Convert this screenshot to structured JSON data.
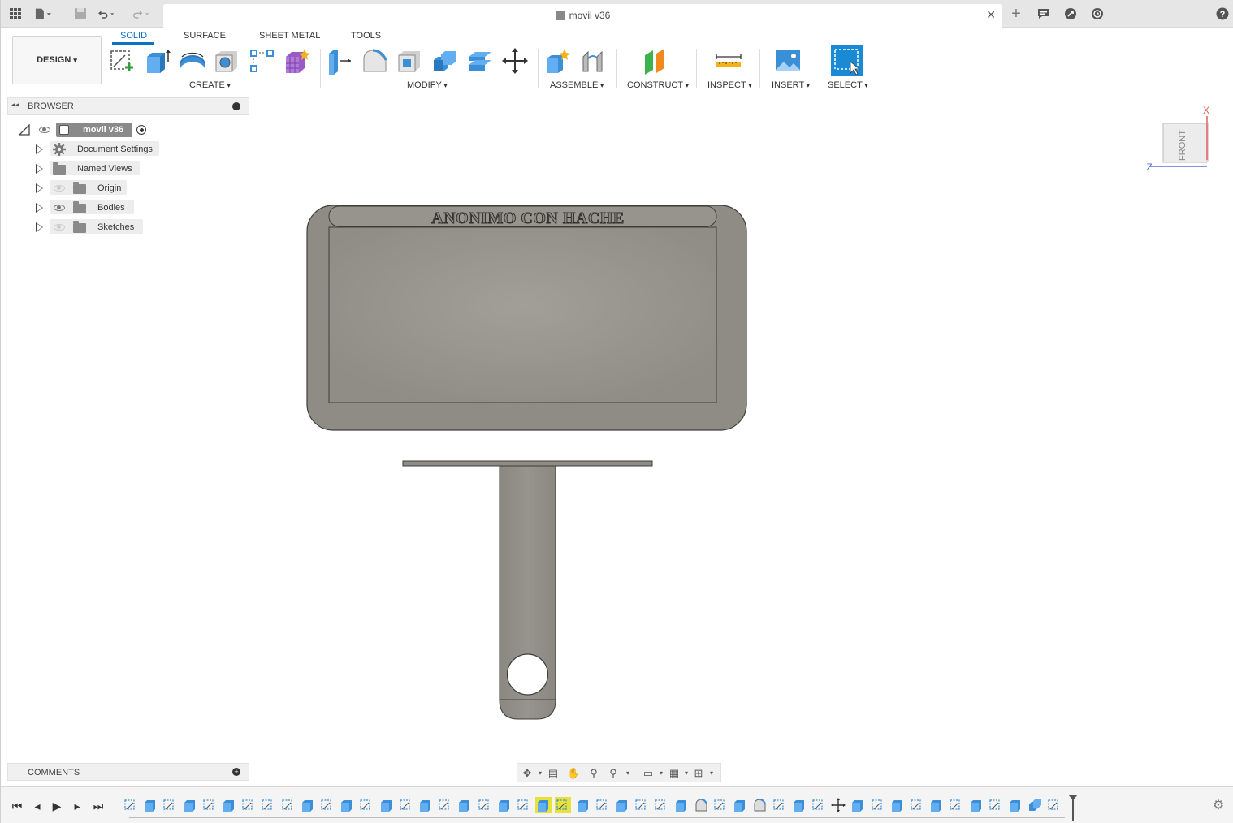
{
  "window": {
    "doc_title": "movil v36"
  },
  "ribbon": {
    "workspace": "DESIGN",
    "tabs": [
      "SOLID",
      "SURFACE",
      "SHEET METAL",
      "TOOLS"
    ],
    "active_tab": "SOLID",
    "groups": {
      "create": "CREATE",
      "modify": "MODIFY",
      "assemble": "ASSEMBLE",
      "construct": "CONSTRUCT",
      "inspect": "INSPECT",
      "insert": "INSERT",
      "select": "SELECT"
    }
  },
  "browser": {
    "title": "BROWSER",
    "root": "movil v36",
    "items": [
      {
        "label": "Document Settings",
        "icon": "gear-icon",
        "visible": null
      },
      {
        "label": "Named Views",
        "icon": "folder-icon",
        "visible": null
      },
      {
        "label": "Origin",
        "icon": "folder-icon",
        "visible": false
      },
      {
        "label": "Bodies",
        "icon": "folder-icon",
        "visible": true
      },
      {
        "label": "Sketches",
        "icon": "folder-icon",
        "visible": false
      }
    ]
  },
  "viewport": {
    "engraved_text": "ANONIMO CON HACHE",
    "viewcube": {
      "face": "FRONT",
      "axis_x": "X",
      "axis_z": "Z"
    }
  },
  "comments": {
    "title": "COMMENTS"
  },
  "colors": {
    "accent": "#0b73c7",
    "model_fill": "#8e8c84",
    "model_inner": "#9c9a93",
    "timeline_feature": "#3b8fd6",
    "timeline_highlight": "#e8e13a"
  }
}
